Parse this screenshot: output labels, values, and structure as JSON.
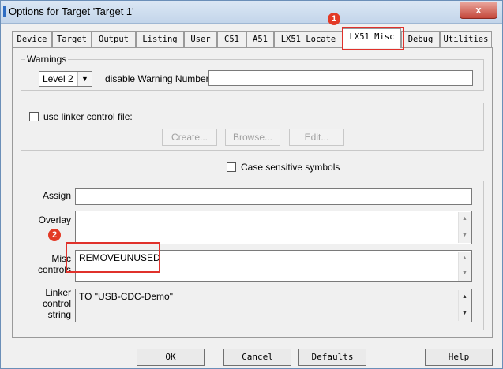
{
  "window": {
    "title": "Options for Target 'Target 1'",
    "close_glyph": "x"
  },
  "tabs": [
    {
      "label": "Device"
    },
    {
      "label": "Target"
    },
    {
      "label": "Output"
    },
    {
      "label": "Listing"
    },
    {
      "label": "User"
    },
    {
      "label": "C51"
    },
    {
      "label": "A51"
    },
    {
      "label": "LX51 Locate"
    },
    {
      "label": "LX51 Misc"
    },
    {
      "label": "Debug"
    },
    {
      "label": "Utilities"
    }
  ],
  "active_tab": "LX51 Misc",
  "warnings": {
    "group_label": "Warnings",
    "level_value": "Level 2",
    "disable_label": "disable Warning Numbers:",
    "disable_value": ""
  },
  "linker_file": {
    "checkbox_label": "use linker control file:",
    "checked": false,
    "create_label": "Create...",
    "browse_label": "Browse...",
    "edit_label": "Edit..."
  },
  "case_sensitive": {
    "label": "Case sensitive symbols",
    "checked": false
  },
  "fields": {
    "assign_label": "Assign",
    "assign_value": "",
    "overlay_label": "Overlay",
    "overlay_value": "",
    "misc_label_1": "Misc",
    "misc_label_2": "controls",
    "misc_value": "REMOVEUNUSED",
    "linker_label_1": "Linker",
    "linker_label_2": "control",
    "linker_label_3": "string",
    "linker_value": "TO \"USB-CDC-Demo\""
  },
  "annotations": {
    "badge_1": "1",
    "badge_2": "2",
    "color": "#e0312b"
  },
  "buttons": {
    "ok": "OK",
    "cancel": "Cancel",
    "defaults": "Defaults",
    "help": "Help"
  }
}
